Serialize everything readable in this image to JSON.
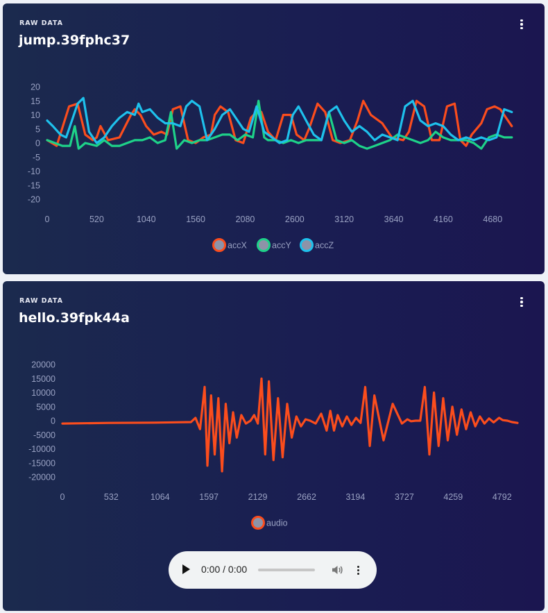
{
  "charts": [
    {
      "kicker": "RAW DATA",
      "title": "jump.39fphc37",
      "menu_icon": "more-vertical-icon"
    },
    {
      "kicker": "RAW DATA",
      "title": "hello.39fpk44a",
      "menu_icon": "more-vertical-icon"
    }
  ],
  "audio_player": {
    "time": "0:00 / 0:00",
    "play_icon": "play-icon",
    "volume_icon": "volume-icon",
    "menu_icon": "more-vertical-icon"
  },
  "chart_data": [
    {
      "type": "line",
      "xlim": [
        0,
        4940
      ],
      "ylim": [
        -20,
        20
      ],
      "x_ticks": [
        0,
        520,
        1040,
        1560,
        2080,
        2600,
        3120,
        3640,
        4160,
        4680
      ],
      "y_ticks": [
        20,
        15,
        10,
        5,
        0,
        -5,
        -10,
        -15,
        -20
      ],
      "legend_position": "bottom-center",
      "series": [
        {
          "name": "accX",
          "color": "#fb4d1d",
          "x": [
            0,
            100,
            230,
            320,
            400,
            480,
            520,
            560,
            640,
            760,
            880,
            920,
            980,
            1040,
            1120,
            1200,
            1260,
            1320,
            1400,
            1480,
            1560,
            1640,
            1720,
            1760,
            1820,
            1900,
            1980,
            2060,
            2140,
            2200,
            2250,
            2320,
            2400,
            2480,
            2560,
            2620,
            2700,
            2750,
            2840,
            2920,
            3000,
            3080,
            3180,
            3260,
            3320,
            3400,
            3520,
            3620,
            3740,
            3800,
            3880,
            3960,
            4040,
            4120,
            4200,
            4280,
            4340,
            4400,
            4460,
            4560,
            4620,
            4700,
            4760,
            4820,
            4880
          ],
          "y": [
            1,
            -1,
            13,
            14,
            3,
            1,
            2,
            6,
            1,
            2,
            10,
            12,
            10,
            6,
            3,
            4,
            3,
            12,
            13,
            1,
            0,
            2,
            3,
            10,
            13,
            11,
            1,
            0,
            9,
            11,
            11,
            4,
            1,
            10,
            10,
            3,
            1,
            5,
            14,
            11,
            1,
            0,
            1,
            8,
            15,
            10,
            7,
            2,
            1,
            4,
            15,
            13,
            1,
            1,
            13,
            14,
            1,
            -1,
            3,
            7,
            12,
            13,
            12,
            9,
            6
          ]
        },
        {
          "name": "accY",
          "color": "#1ed289",
          "x": [
            0,
            80,
            160,
            240,
            290,
            330,
            400,
            520,
            600,
            680,
            760,
            840,
            920,
            1000,
            1080,
            1160,
            1240,
            1300,
            1360,
            1440,
            1520,
            1600,
            1680,
            1760,
            1840,
            1920,
            2000,
            2080,
            2160,
            2220,
            2280,
            2320,
            2400,
            2480,
            2560,
            2640,
            2720,
            2800,
            2880,
            2960,
            3040,
            3120,
            3200,
            3280,
            3360,
            3440,
            3520,
            3600,
            3680,
            3760,
            3840,
            3920,
            4000,
            4080,
            4160,
            4240,
            4320,
            4400,
            4480,
            4560,
            4640,
            4720,
            4800,
            4880
          ],
          "y": [
            1,
            0,
            -1,
            -1,
            6,
            -2,
            0,
            -1,
            1,
            -1,
            -1,
            0,
            1,
            1,
            2,
            0,
            1,
            11,
            -2,
            1,
            0,
            1,
            1,
            2,
            3,
            3,
            1,
            3,
            2,
            15,
            2,
            1,
            1,
            0,
            1,
            0,
            1,
            1,
            1,
            11,
            1,
            0,
            1,
            -1,
            -2,
            -1,
            0,
            1,
            3,
            2,
            1,
            0,
            1,
            4,
            2,
            1,
            1,
            1,
            0,
            -2,
            2,
            3,
            2,
            2
          ]
        },
        {
          "name": "accZ",
          "color": "#1ec1ec",
          "x": [
            0,
            60,
            140,
            200,
            260,
            320,
            380,
            440,
            520,
            600,
            680,
            760,
            840,
            920,
            960,
            1000,
            1080,
            1160,
            1240,
            1320,
            1400,
            1460,
            1520,
            1600,
            1680,
            1760,
            1840,
            1920,
            2000,
            2060,
            2120,
            2200,
            2280,
            2360,
            2440,
            2520,
            2580,
            2640,
            2720,
            2800,
            2880,
            2960,
            3040,
            3120,
            3200,
            3280,
            3360,
            3440,
            3520,
            3600,
            3680,
            3760,
            3840,
            3920,
            4000,
            4080,
            4160,
            4240,
            4320,
            4400,
            4480,
            4560,
            4640,
            4720,
            4800,
            4880
          ],
          "y": [
            8,
            6,
            3,
            2,
            8,
            14,
            16,
            4,
            0,
            2,
            6,
            9,
            11,
            10,
            14,
            11,
            12,
            9,
            7,
            7,
            6,
            13,
            15,
            13,
            1,
            5,
            10,
            12,
            8,
            5,
            4,
            13,
            4,
            2,
            0,
            1,
            10,
            13,
            8,
            3,
            1,
            11,
            13,
            8,
            4,
            6,
            4,
            1,
            3,
            2,
            1,
            13,
            15,
            8,
            6,
            7,
            6,
            3,
            1,
            2,
            1,
            2,
            1,
            2,
            12,
            11
          ]
        }
      ]
    },
    {
      "type": "line",
      "xlim": [
        0,
        4960
      ],
      "ylim": [
        -20000,
        20000
      ],
      "x_ticks": [
        0,
        532,
        1064,
        1597,
        2129,
        2662,
        3194,
        3727,
        4259,
        4792
      ],
      "y_ticks": [
        20000,
        15000,
        10000,
        5000,
        0,
        -5000,
        -10000,
        -15000,
        -20000
      ],
      "legend_position": "bottom-center",
      "series": [
        {
          "name": "audio",
          "color": "#fb4d1d",
          "x": [
            0,
            500,
            1000,
            1400,
            1450,
            1500,
            1550,
            1580,
            1620,
            1660,
            1700,
            1740,
            1780,
            1820,
            1860,
            1900,
            1950,
            2000,
            2050,
            2090,
            2130,
            2170,
            2210,
            2250,
            2300,
            2350,
            2400,
            2450,
            2500,
            2550,
            2600,
            2650,
            2700,
            2760,
            2820,
            2880,
            2920,
            2960,
            3000,
            3050,
            3100,
            3150,
            3200,
            3250,
            3300,
            3350,
            3400,
            3500,
            3600,
            3700,
            3760,
            3800,
            3850,
            3900,
            3950,
            4000,
            4050,
            4100,
            4150,
            4200,
            4250,
            4300,
            4350,
            4400,
            4450,
            4500,
            4550,
            4600,
            4650,
            4700,
            4760,
            4800,
            4850,
            4900,
            4960
          ],
          "y": [
            -1000,
            -800,
            -700,
            -500,
            1000,
            -3000,
            12000,
            -16000,
            9000,
            -12000,
            8000,
            -18000,
            6000,
            -8000,
            3000,
            -6000,
            2000,
            -1000,
            0,
            2000,
            -1000,
            15000,
            -12000,
            14000,
            -14000,
            8000,
            -13000,
            6000,
            -6000,
            1500,
            -2000,
            500,
            0,
            -1000,
            2500,
            -3500,
            3500,
            -3500,
            2000,
            -2000,
            1500,
            -1500,
            1000,
            -800,
            12000,
            -9000,
            9000,
            -7000,
            6000,
            -1000,
            500,
            -200,
            0,
            0,
            12000,
            -12000,
            10000,
            -9000,
            8000,
            -7000,
            5000,
            -5000,
            4000,
            -3000,
            3000,
            -2000,
            1500,
            -1000,
            800,
            -600,
            1000,
            200,
            0,
            -500,
            -800
          ]
        }
      ]
    }
  ]
}
